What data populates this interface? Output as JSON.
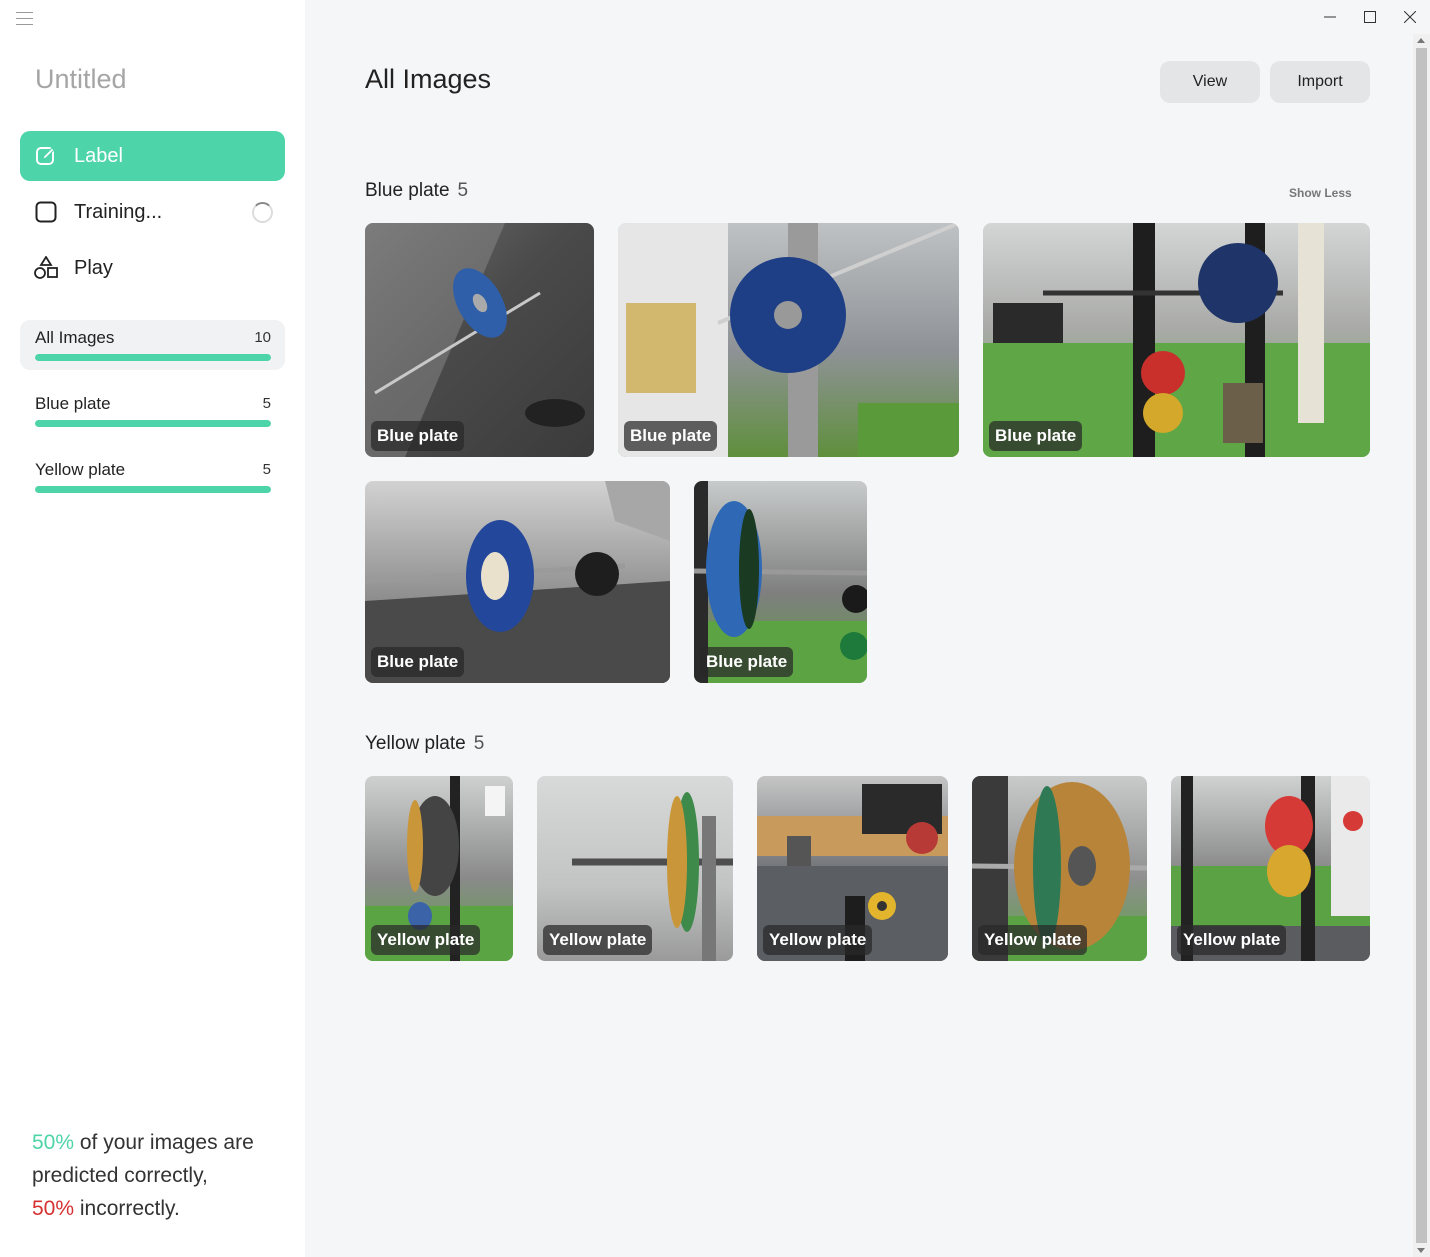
{
  "sidebar": {
    "title": "Untitled",
    "nav": [
      {
        "label": "Label",
        "active": true,
        "icon": "edit-icon"
      },
      {
        "label": "Training...",
        "active": false,
        "icon": "square-icon"
      },
      {
        "label": "Play",
        "active": false,
        "icon": "shapes-icon"
      }
    ],
    "labels": [
      {
        "name": "All Images",
        "count": "10",
        "progress": 1.0,
        "selected": true
      },
      {
        "name": "Blue plate",
        "count": "5",
        "progress": 1.0,
        "selected": false
      },
      {
        "name": "Yellow plate",
        "count": "5",
        "progress": 1.0,
        "selected": false
      }
    ],
    "stats": {
      "correct_pct": "50%",
      "correct_text": " of your images are predicted correctly,",
      "incorrect_pct": "50%",
      "incorrect_text": " incorrectly."
    }
  },
  "header": {
    "title": "All Images",
    "view_label": "View",
    "import_label": "Import"
  },
  "sections": [
    {
      "title": "Blue plate",
      "count": "5",
      "show_less": "Show Less",
      "images": [
        {
          "tag": "Blue plate"
        },
        {
          "tag": "Blue plate"
        },
        {
          "tag": "Blue plate"
        },
        {
          "tag": "Blue plate"
        },
        {
          "tag": "Blue plate"
        }
      ]
    },
    {
      "title": "Yellow plate",
      "count": "5",
      "images": [
        {
          "tag": "Yellow plate"
        },
        {
          "tag": "Yellow plate"
        },
        {
          "tag": "Yellow plate"
        },
        {
          "tag": "Yellow plate"
        },
        {
          "tag": "Yellow plate"
        }
      ]
    }
  ],
  "colors": {
    "accent": "#4dd4a8",
    "error": "#d63131"
  }
}
